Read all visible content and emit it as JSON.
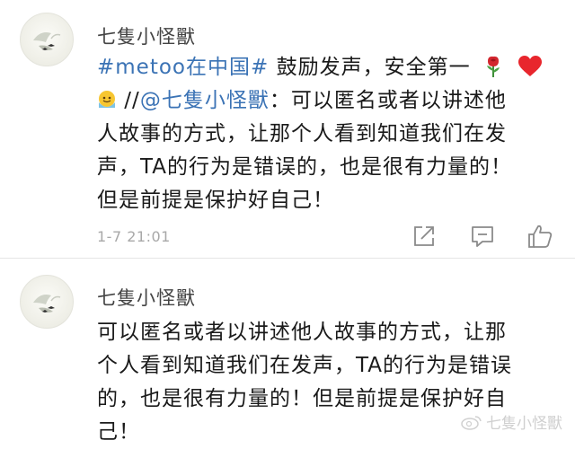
{
  "comments": [
    {
      "username": "七隻小怪獸",
      "hashtag": "#metoo在中国#",
      "line1_text": " 鼓励发声，安全第一",
      "repost_prefix": " //",
      "mention": "@七隻小怪獸",
      "line2_text": "：可以匿名或者以讲述他",
      "lines": [
        "人故事的方式，让那个人看到知道我们在发",
        "声，TA的行为是错误的，也是很有力量的！",
        "但是前提是保护好自己！"
      ],
      "timestamp": "1-7 21:01",
      "icons": [
        "rose-icon",
        "heart-icon",
        "smiling-face-icon"
      ]
    },
    {
      "username": "七隻小怪獸",
      "lines": [
        "可以匿名或者以讲述他人故事的方式，让那",
        "个人看到知道我们在发声，TA的行为是错误",
        "的，也是很有力量的！但是前提是保护好自",
        "己！"
      ]
    }
  ],
  "watermark": {
    "text": "七隻小怪獸"
  },
  "actions": {
    "icons": [
      "share-icon",
      "comment-icon",
      "like-icon"
    ]
  },
  "colors": {
    "link": "#3b73b5",
    "timestamp": "#a8a8a8",
    "divider": "#e6e6e6"
  }
}
